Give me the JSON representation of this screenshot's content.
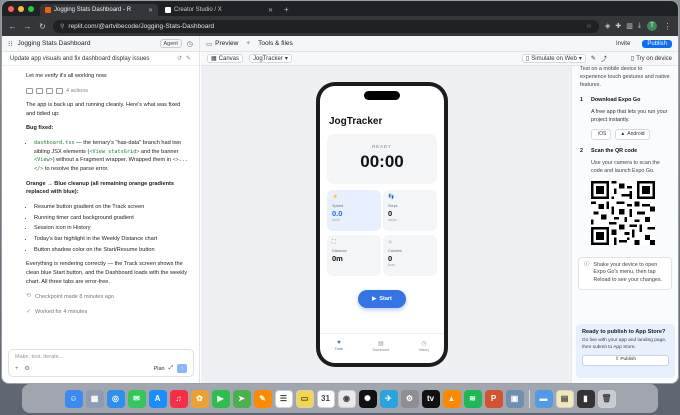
{
  "browser": {
    "tabs": [
      {
        "label": "Jogging Stats Dashboard - R",
        "active": true,
        "color": "#f26207"
      },
      {
        "label": "Creator Studio / X",
        "active": false,
        "color": "#ffffff"
      }
    ],
    "new_tab": "+",
    "url": "replit.com/@artvibecode/Jogging-Stats-Dashboard",
    "profile_initial": "T"
  },
  "replit": {
    "project_title": "Jogging Stats Dashboard",
    "agent_badge": "Agent",
    "preview_tab": "Preview",
    "tools_label": "Tools & files",
    "invite_label": "Invite",
    "publish_label": "Publish"
  },
  "chat": {
    "thread_title": "Update app visuals and fix dashboard display issues",
    "intro": "Let me verify it's all working now:",
    "actions_count": "4 actions",
    "p1": "The app is back up and running cleanly. Here's what was fixed and tidied up:",
    "bug_heading": "Bug fixed:",
    "bug_code1": "dashboard.tsx",
    "bug_text1": " — the ternary's \"has-data\" branch had two sibling JSX elements (",
    "bug_code2": "<View statsGrid>",
    "bug_text2": " and the banner ",
    "bug_code3": "<View>",
    "bug_text3": ") without a Fragment wrapper. Wrapped them in ",
    "bug_code4": "<>...</>",
    "bug_text4": " to resolve the parse error.",
    "cleanup_heading": "Orange → Blue cleanup (all remaining orange gradients replaced with blue):",
    "cleanup_items": [
      "Resume button gradient on the Track screen",
      "Running timer card background gradient",
      "Session icon in History",
      "Today's bar highlight in the Weekly Distance chart",
      "Button shadow color on the Start/Resume button"
    ],
    "summary": "Everything is rendering correctly — the Track screen shows the clean blue Start button, and the Dashboard loads with the weekly chart. All three tabs are error-free.",
    "checkpoint": "Checkpoint made 8 minutes ago",
    "worked": "Worked for 4 minutes",
    "input_placeholder": "Make, test, iterate...",
    "plan_label": "Plan"
  },
  "preview": {
    "canvas_label": "Canvas",
    "app_chip": "JogTracker",
    "simulate_label": "Simulate on Web",
    "try_device": "Try on device"
  },
  "phone": {
    "app_title": "JogTracker",
    "status": "READY",
    "timer": "00:00",
    "stats": [
      {
        "label": "Speed",
        "value": "0.0",
        "unit": "km/h",
        "icon": "lightning-icon",
        "glyph": "⚡",
        "highlight": true
      },
      {
        "label": "Steps",
        "value": "0",
        "unit": "steps",
        "icon": "footprints-icon",
        "glyph": "👣",
        "highlight": false
      },
      {
        "label": "Distance",
        "value": "0m",
        "unit": "",
        "icon": "map-icon",
        "glyph": "⛶",
        "highlight": false
      },
      {
        "label": "Calories",
        "value": "0",
        "unit": "kcal",
        "icon": "flame-icon",
        "glyph": "♨",
        "highlight": false
      }
    ],
    "start_label": "Start",
    "nav": [
      {
        "label": "Track",
        "icon": "heart-icon",
        "glyph": "♥",
        "active": true
      },
      {
        "label": "Dashboard",
        "icon": "chart-icon",
        "glyph": "▤",
        "active": false
      },
      {
        "label": "History",
        "icon": "clock-icon",
        "glyph": "◷",
        "active": false
      }
    ]
  },
  "device_panel": {
    "top_text": "Test on a mobile device to experience touch gestures and native features.",
    "step1_num": "1",
    "step1_title": "Download Expo Go",
    "step1_desc": "A free app that lets you run your project instantly.",
    "ios_label": "iOS",
    "android_label": "Android",
    "step2_num": "2",
    "step2_title": "Scan the QR code",
    "step2_desc": "Use your camera to scan the code and launch Expo Go.",
    "shake_note": "Shake your device to open Expo Go's menu, then tap Reload to see your changes.",
    "publish_title": "Ready to publish to App Store?",
    "publish_desc": "Go live with your app and landing page, then submit to App Store.",
    "publish_button": "Publish"
  },
  "dock": [
    {
      "name": "finder",
      "color": "#3d8bf2",
      "glyph": "☺"
    },
    {
      "name": "launchpad",
      "color": "#8f9bb3",
      "glyph": "▦"
    },
    {
      "name": "safari",
      "color": "#2e8ff0",
      "glyph": "◎"
    },
    {
      "name": "messages",
      "color": "#34c759",
      "glyph": "✉"
    },
    {
      "name": "app-store",
      "color": "#1c8dff",
      "glyph": "A"
    },
    {
      "name": "music",
      "color": "#fa2d48",
      "glyph": "♫"
    },
    {
      "name": "photos",
      "color": "#f0a030",
      "glyph": "✿"
    },
    {
      "name": "facetime",
      "color": "#2dbe4e",
      "glyph": "▶"
    },
    {
      "name": "maps",
      "color": "#4caf50",
      "glyph": "➤"
    },
    {
      "name": "pages",
      "color": "#ff8a00",
      "glyph": "✎"
    },
    {
      "name": "reminders",
      "color": "#ffffff",
      "glyph": "☰"
    },
    {
      "name": "notes",
      "color": "#f7d54a",
      "glyph": "▭"
    },
    {
      "name": "calendar",
      "color": "#ffffff",
      "glyph": "31"
    },
    {
      "name": "chrome",
      "color": "#e9e9e9",
      "glyph": "◉"
    },
    {
      "name": "chatgpt",
      "color": "#111111",
      "glyph": "✺"
    },
    {
      "name": "telegram",
      "color": "#2aa3de",
      "glyph": "✈"
    },
    {
      "name": "settings",
      "color": "#8e8e93",
      "glyph": "⚙"
    },
    {
      "name": "apple-tv",
      "color": "#111111",
      "glyph": "tv"
    },
    {
      "name": "vlc",
      "color": "#ff8800",
      "glyph": "▲"
    },
    {
      "name": "spotify",
      "color": "#1db954",
      "glyph": "≋"
    },
    {
      "name": "powerpoint",
      "color": "#d35230",
      "glyph": "P"
    },
    {
      "name": "preview",
      "color": "#6f8fb0",
      "glyph": "▣"
    },
    {
      "name": "sep",
      "color": "",
      "glyph": ""
    },
    {
      "name": "folder",
      "color": "#4f9be8",
      "glyph": "▬"
    },
    {
      "name": "notes-stack",
      "color": "#f3e9b8",
      "glyph": "▤"
    },
    {
      "name": "screenshot",
      "color": "#333333",
      "glyph": "▮"
    },
    {
      "name": "trash",
      "color": "#c8ccd2",
      "glyph": "🗑"
    }
  ]
}
